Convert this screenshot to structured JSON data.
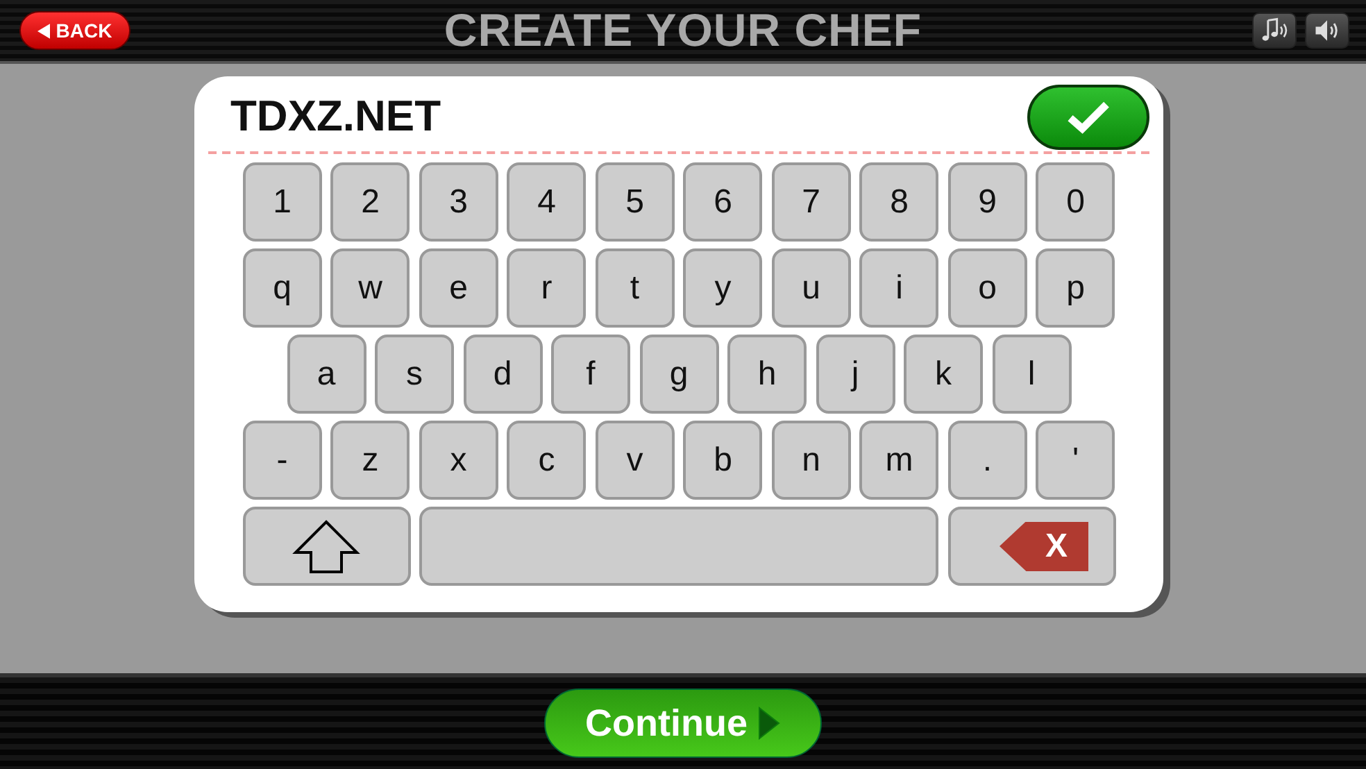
{
  "header": {
    "back_label": "BACK",
    "title": "CREATE YOUR CHEF"
  },
  "name_field": {
    "value": "TDXZ.NET"
  },
  "keyboard": {
    "rows": [
      {
        "keys": [
          {
            "kind": "char",
            "label": "1"
          },
          {
            "kind": "char",
            "label": "2"
          },
          {
            "kind": "char",
            "label": "3"
          },
          {
            "kind": "char",
            "label": "4"
          },
          {
            "kind": "char",
            "label": "5"
          },
          {
            "kind": "char",
            "label": "6"
          },
          {
            "kind": "char",
            "label": "7"
          },
          {
            "kind": "char",
            "label": "8"
          },
          {
            "kind": "char",
            "label": "9"
          },
          {
            "kind": "char",
            "label": "0"
          }
        ]
      },
      {
        "keys": [
          {
            "kind": "char",
            "label": "q"
          },
          {
            "kind": "char",
            "label": "w"
          },
          {
            "kind": "char",
            "label": "e"
          },
          {
            "kind": "char",
            "label": "r"
          },
          {
            "kind": "char",
            "label": "t"
          },
          {
            "kind": "char",
            "label": "y"
          },
          {
            "kind": "char",
            "label": "u"
          },
          {
            "kind": "char",
            "label": "i"
          },
          {
            "kind": "char",
            "label": "o"
          },
          {
            "kind": "char",
            "label": "p"
          }
        ]
      },
      {
        "keys": [
          {
            "kind": "char",
            "label": "a"
          },
          {
            "kind": "char",
            "label": "s"
          },
          {
            "kind": "char",
            "label": "d"
          },
          {
            "kind": "char",
            "label": "f"
          },
          {
            "kind": "char",
            "label": "g"
          },
          {
            "kind": "char",
            "label": "h"
          },
          {
            "kind": "char",
            "label": "j"
          },
          {
            "kind": "char",
            "label": "k"
          },
          {
            "kind": "char",
            "label": "l"
          }
        ]
      },
      {
        "keys": [
          {
            "kind": "char",
            "label": "-"
          },
          {
            "kind": "char",
            "label": "z"
          },
          {
            "kind": "char",
            "label": "x"
          },
          {
            "kind": "char",
            "label": "c"
          },
          {
            "kind": "char",
            "label": "v"
          },
          {
            "kind": "char",
            "label": "b"
          },
          {
            "kind": "char",
            "label": "n"
          },
          {
            "kind": "char",
            "label": "m"
          },
          {
            "kind": "char",
            "label": "."
          },
          {
            "kind": "char",
            "label": "'"
          }
        ]
      },
      {
        "keys": [
          {
            "kind": "shift"
          },
          {
            "kind": "space"
          },
          {
            "kind": "backspace",
            "label": "X"
          }
        ]
      }
    ]
  },
  "footer": {
    "continue_label": "Continue"
  }
}
